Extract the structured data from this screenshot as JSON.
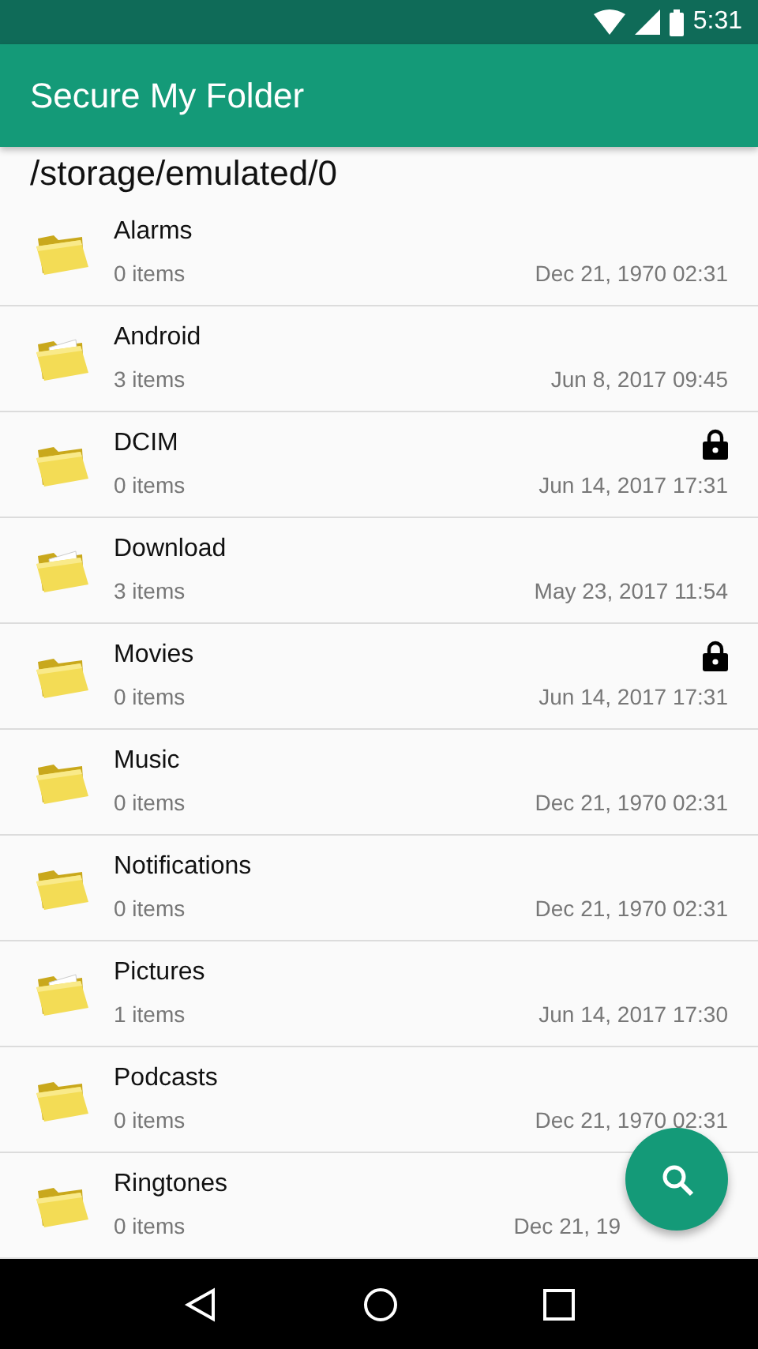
{
  "status_bar": {
    "time": "5:31"
  },
  "app_bar": {
    "title": "Secure My Folder"
  },
  "path": "/storage/emulated/0",
  "folders": [
    {
      "name": "Alarms",
      "count": "0 items",
      "date": "Dec 21, 1970 02:31",
      "kind": "empty",
      "locked": false
    },
    {
      "name": "Android",
      "count": "3 items",
      "date": "Jun 8, 2017 09:45",
      "kind": "files",
      "locked": false
    },
    {
      "name": "DCIM",
      "count": "0 items",
      "date": "Jun 14, 2017 17:31",
      "kind": "empty",
      "locked": true
    },
    {
      "name": "Download",
      "count": "3 items",
      "date": "May 23, 2017 11:54",
      "kind": "files",
      "locked": false
    },
    {
      "name": "Movies",
      "count": "0 items",
      "date": "Jun 14, 2017 17:31",
      "kind": "empty",
      "locked": true
    },
    {
      "name": "Music",
      "count": "0 items",
      "date": "Dec 21, 1970 02:31",
      "kind": "empty",
      "locked": false
    },
    {
      "name": "Notifications",
      "count": "0 items",
      "date": "Dec 21, 1970 02:31",
      "kind": "empty",
      "locked": false
    },
    {
      "name": "Pictures",
      "count": "1 items",
      "date": "Jun 14, 2017 17:30",
      "kind": "files",
      "locked": false
    },
    {
      "name": "Podcasts",
      "count": "0 items",
      "date": "Dec 21, 1970 02:31",
      "kind": "empty",
      "locked": false
    },
    {
      "name": "Ringtones",
      "count": "0 items",
      "date": "Dec 21, 19",
      "kind": "empty",
      "locked": false
    }
  ]
}
